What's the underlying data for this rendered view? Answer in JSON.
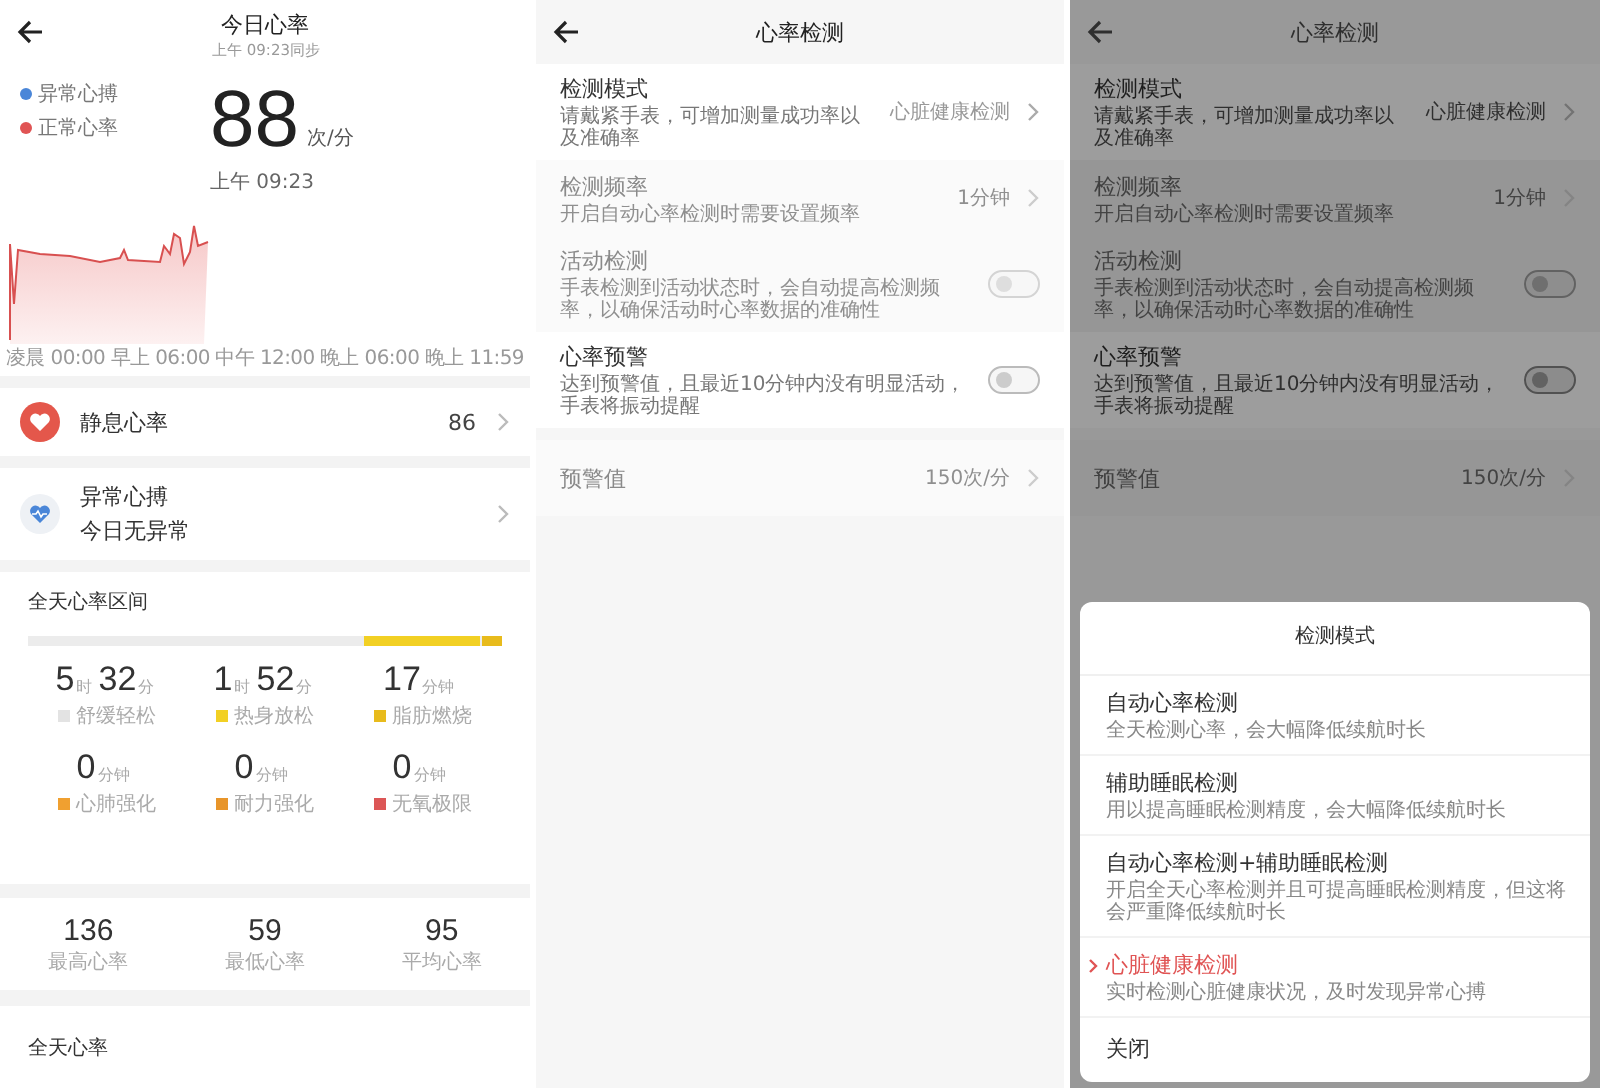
{
  "today": {
    "title": "今日心率",
    "sync_time": "上午 09:23同步",
    "legend": [
      {
        "label": "异常心搏",
        "color": "#4a86d8"
      },
      {
        "label": "正常心率",
        "color": "#e05454"
      }
    ],
    "current": {
      "value": "88",
      "unit": "次/分",
      "time": "上午 09:23"
    },
    "chart_axis": [
      "凌晨 00:00",
      "早上 06:00",
      "中午 12:00",
      "晚上 06:00",
      "晚上 11:59"
    ],
    "resting": {
      "label": "静息心率",
      "value": "86"
    },
    "abnormal": {
      "label": "异常心搏",
      "status": "今日无异常"
    },
    "zones": {
      "title": "全天心率区间",
      "items": [
        {
          "parts": [
            {
              "num": "5",
              "unit": "时"
            },
            {
              "num": "32",
              "unit": "分"
            }
          ],
          "label": "舒缓轻松",
          "color": "#e3e3e3"
        },
        {
          "parts": [
            {
              "num": "1",
              "unit": "时"
            },
            {
              "num": "52",
              "unit": "分"
            }
          ],
          "label": "热身放松",
          "color": "#f2d024"
        },
        {
          "parts": [
            {
              "num": "17",
              "unit": "分钟"
            }
          ],
          "label": "脂肪燃烧",
          "color": "#e8bb1c"
        },
        {
          "parts": [
            {
              "num": "0",
              "unit": "分钟"
            }
          ],
          "label": "心肺强化",
          "color": "#f0a030"
        },
        {
          "parts": [
            {
              "num": "0",
              "unit": "分钟"
            }
          ],
          "label": "耐力强化",
          "color": "#e8952a"
        },
        {
          "parts": [
            {
              "num": "0",
              "unit": "分钟"
            }
          ],
          "label": "无氧极限",
          "color": "#dc5656"
        }
      ]
    },
    "stats": [
      {
        "value": "136",
        "label": "最高心率"
      },
      {
        "value": "59",
        "label": "最低心率"
      },
      {
        "value": "95",
        "label": "平均心率"
      }
    ],
    "section_title": "全天心率"
  },
  "settings": {
    "title": "心率检测",
    "rows": [
      {
        "kind": "link",
        "label": "检测模式",
        "description": "请戴紧手表，可增加测量成功率以及准确率",
        "value": "心脏健康检测",
        "disabled": false
      },
      {
        "kind": "link",
        "label": "检测频率",
        "description": "开启自动心率检测时需要设置频率",
        "value": "1分钟",
        "disabled": true
      },
      {
        "kind": "toggle",
        "label": "活动检测",
        "description": "手表检测到活动状态时，会自动提高检测频率，以确保活动时心率数据的准确性",
        "on": false,
        "disabled": true
      },
      {
        "kind": "toggle",
        "label": "心率预警",
        "description": "达到预警值，且最近10分钟内没有明显活动，手表将振动提醒",
        "on": false,
        "disabled": false
      },
      {
        "kind": "link",
        "label": "预警值",
        "value": "150次/分",
        "disabled": true
      }
    ]
  },
  "settings_behind_sheet": {
    "title": "心率检测",
    "rows": [
      {
        "kind": "link",
        "label": "检测模式",
        "description": "请戴紧手表，可增加测量成功率以及准确率",
        "value": "心脏健康检测",
        "disabled": false
      },
      {
        "kind": "link",
        "label": "检测频率",
        "description": "开启自动心率检测时需要设置频率",
        "value": "1分钟",
        "disabled": true
      },
      {
        "kind": "toggle",
        "label": "活动检测",
        "description": "手表检测到活动状态时，会自动提高检测频率，以确保活动时心率数据的准确性",
        "on": false,
        "disabled": true
      },
      {
        "kind": "toggle",
        "label": "心率预警",
        "description": "达到预警值，且最近10分钟内没有明显活动，手表将振动提醒",
        "on": false,
        "disabled": false
      },
      {
        "kind": "link",
        "label": "预警值",
        "value": "150次/分",
        "disabled": true
      }
    ]
  },
  "mode_sheet": {
    "title": "检测模式",
    "options": [
      {
        "label": "自动心率检测",
        "description": "全天检测心率，会大幅降低续航时长",
        "selected": false
      },
      {
        "label": "辅助睡眠检测",
        "description": "用以提高睡眠检测精度，会大幅降低续航时长",
        "selected": false
      },
      {
        "label": "自动心率检测+辅助睡眠检测",
        "description": "开启全天心率检测并且可提高睡眠检测精度，但这将会严重降低续航时长",
        "selected": false
      },
      {
        "label": "心脏健康检测",
        "description": "实时检测心脏健康状况，及时发现异常心搏",
        "selected": true
      }
    ],
    "close": "关闭"
  }
}
